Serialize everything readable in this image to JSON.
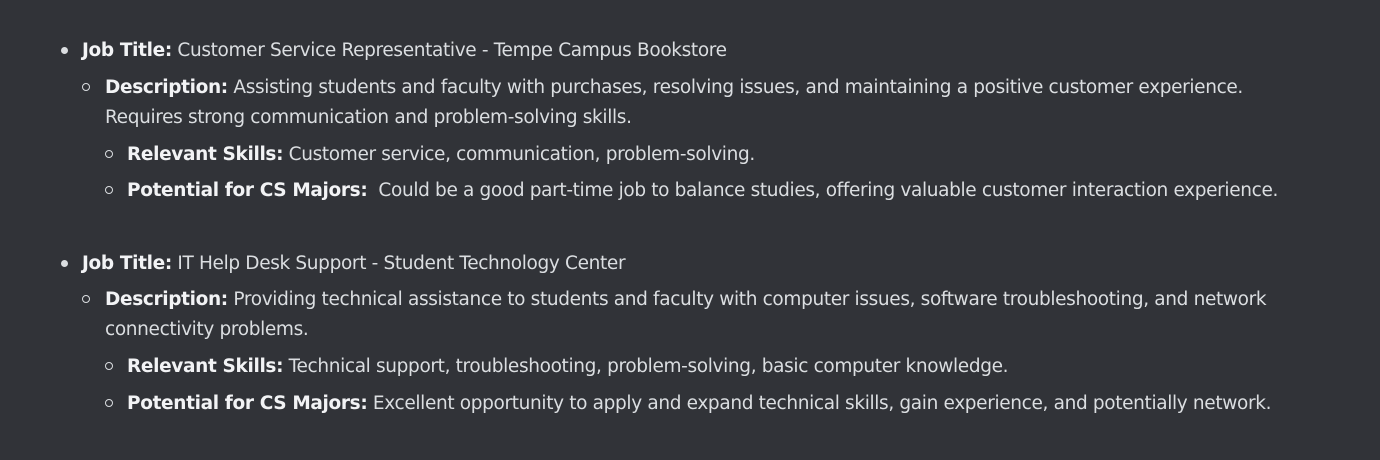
{
  "labels": {
    "job_title": "Job Title:",
    "description": "Description:",
    "relevant_skills": "Relevant Skills:",
    "potential": "Potential for CS Majors:"
  },
  "jobs": [
    {
      "title": "Customer Service Representative - Tempe Campus Bookstore",
      "description_line1": "Assisting students and faculty with purchases, resolving issues, and maintaining a positive customer experience.",
      "description_line2": "Requires strong communication and problem-solving skills.",
      "skills": "Customer service, communication, problem-solving.",
      "potential": " Could be a good part-time job to balance studies, offering valuable customer interaction experience."
    },
    {
      "title": "IT Help Desk Support - Student Technology Center",
      "description_line1": "Providing technical assistance to students and faculty with computer issues, software troubleshooting, and network",
      "description_line2": "connectivity problems.",
      "skills": "Technical support, troubleshooting, problem-solving, basic computer knowledge.",
      "potential": "Excellent opportunity to apply and expand technical skills, gain experience, and potentially network."
    }
  ]
}
